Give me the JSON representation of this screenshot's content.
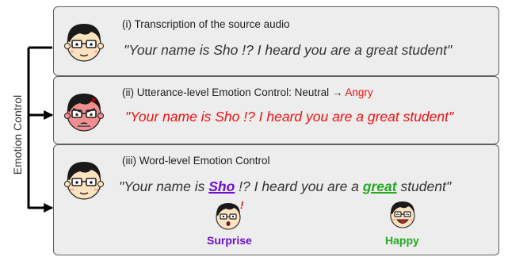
{
  "side_label": "Emotion Control",
  "panels": [
    {
      "title": "(i) Transcription of the source audio",
      "quote": "\"Your name is Sho !? I heard you are a great student\""
    },
    {
      "title_prefix": "(ii) Utterance-level Emotion Control: Neutral ",
      "title_arrow": "→",
      "title_target": "Angry",
      "quote": "\"Your name is Sho !? I heard you are a great student\""
    },
    {
      "title": "(iii) Word-level Emotion Control",
      "quote_part1": "\"Your name is ",
      "word1": "Sho",
      "quote_part2": " !? I heard you are a ",
      "word2": "great",
      "quote_part3": " student\"",
      "label1": "Surprise",
      "label2": "Happy"
    }
  ],
  "colors": {
    "angry": "#ee1111",
    "surprise": "#6a0fd0",
    "happy": "#22aa22",
    "panel_bg": "#ededed",
    "panel_border": "#5f5f5f"
  }
}
